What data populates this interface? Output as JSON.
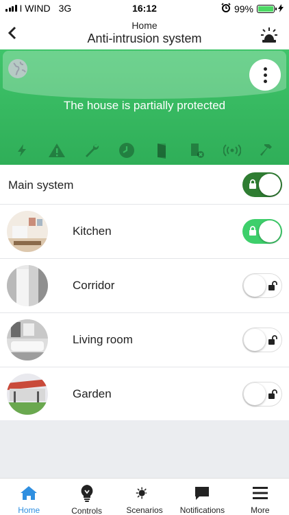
{
  "status_bar": {
    "carrier": "I WIND",
    "network": "3G",
    "time": "16:12",
    "battery": "99%",
    "battery_level": 0.99
  },
  "header": {
    "breadcrumb": "Home",
    "title": "Anti-intrusion system",
    "back_icon": "chevron-left-icon",
    "alarm_icon": "siren-alarm-icon"
  },
  "panel": {
    "status_text": "The house is partially protected",
    "color": "#36b860",
    "status_icons": [
      "lightning-icon",
      "warning-icon",
      "wrench-icon",
      "clock-icon",
      "door-icon",
      "door-excluded-icon",
      "signal-icon",
      "hammer-icon"
    ]
  },
  "main_system": {
    "label": "Main system",
    "armed": true,
    "toggle_color": "#2f7d32"
  },
  "rooms": [
    {
      "label": "Kitchen",
      "armed": true,
      "toggle_color": "#3ecf6b"
    },
    {
      "label": "Corridor",
      "armed": false
    },
    {
      "label": "Living room",
      "armed": false
    },
    {
      "label": "Garden",
      "armed": false
    }
  ],
  "tabbar": {
    "active_color": "#2f8fe0",
    "tabs": [
      {
        "label": "Home",
        "icon": "home-icon",
        "active": true
      },
      {
        "label": "Controls",
        "icon": "bulb-icon",
        "active": false
      },
      {
        "label": "Scenarios",
        "icon": "sun-moon-icon",
        "active": false
      },
      {
        "label": "Notifications",
        "icon": "chat-bubble-icon",
        "active": false
      },
      {
        "label": "More",
        "icon": "menu-icon",
        "active": false
      }
    ]
  }
}
